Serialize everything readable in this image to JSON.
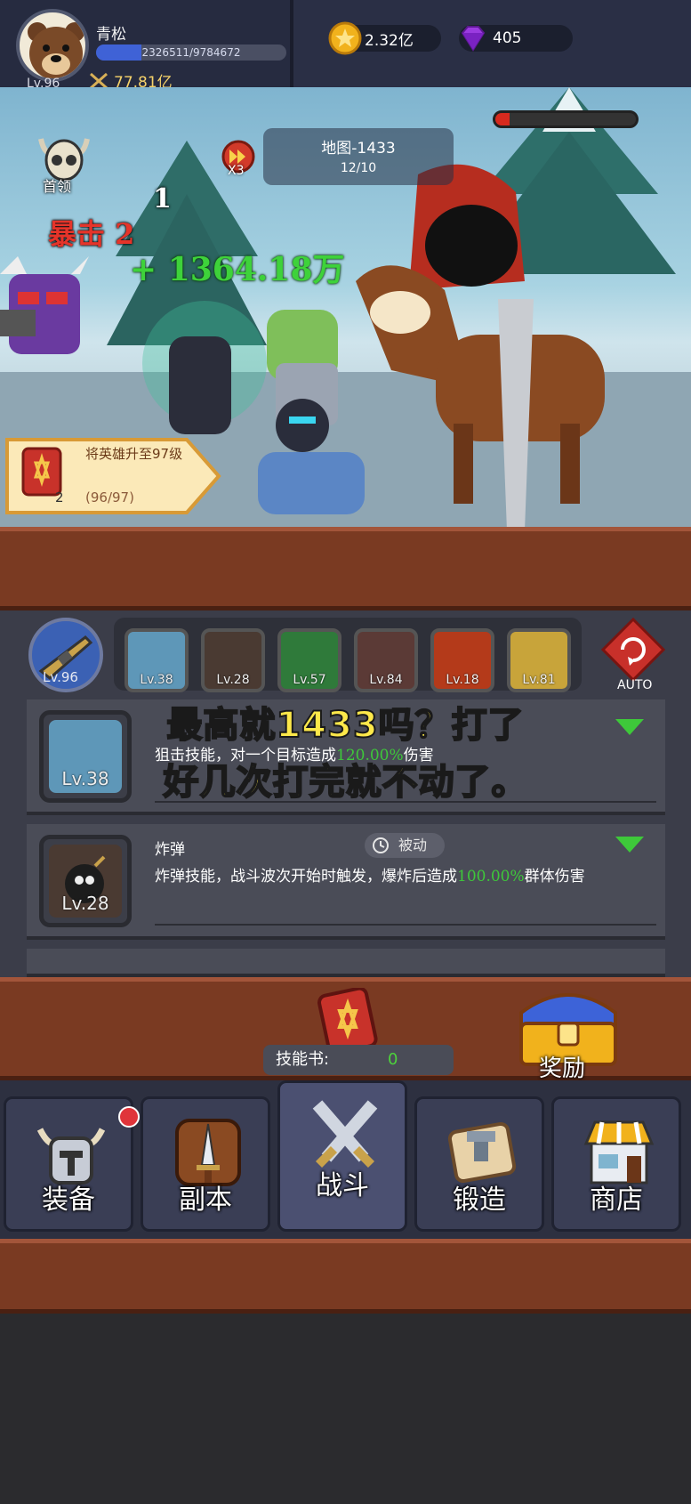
{
  "player": {
    "name": "青松",
    "level": "Lv.96",
    "exp_text": "2326511/9784672",
    "exp_progress": 0.238,
    "power": "77.81亿"
  },
  "resources": {
    "gold": "2.32亿",
    "gems": "405"
  },
  "battle": {
    "boss_label": "首领",
    "speed_label": "X3",
    "map_title": "地图-1433",
    "wave": "12/10",
    "boss_hp_progress": 0.1,
    "damage_number": "1",
    "crit_text": "暴击 2",
    "heal_text": "+ 1364.18万"
  },
  "quest": {
    "title": "将英雄升至97级",
    "progress": "(96/97)",
    "item_count": "2"
  },
  "skills_bar": {
    "weapon_level": "Lv.96",
    "items": [
      {
        "level": "Lv.38",
        "icon": "sniper-skill-icon"
      },
      {
        "level": "Lv.28",
        "icon": "bomb-skill-icon"
      },
      {
        "level": "Lv.57",
        "icon": "poison-skill-icon"
      },
      {
        "level": "Lv.84",
        "icon": "rage-skill-icon"
      },
      {
        "level": "Lv.18",
        "icon": "fireball-skill-icon"
      },
      {
        "level": "Lv.81",
        "icon": "lightning-skill-icon"
      }
    ],
    "auto_label": "AUTO"
  },
  "skill_cards": [
    {
      "name": "",
      "level": "Lv.38",
      "desc_before": "狙击技能，对一个目标造成",
      "desc_pct": "120.00%",
      "desc_after": "伤害"
    },
    {
      "name": "炸弹",
      "level": "Lv.28",
      "badge": "被动",
      "desc_before": "炸弹技能，战斗波次开始时触发，爆炸后造成",
      "desc_pct": "100.00%",
      "desc_after": "群体伤害"
    }
  ],
  "overlay": {
    "line1": "最高就1433吗？打了",
    "line2": "好几次打完就不动了。"
  },
  "footer": {
    "skill_book_label": "技能书:",
    "skill_book_count": "0",
    "reward_label": "奖励"
  },
  "nav": [
    {
      "label": "装备",
      "icon": "equipment-helmet-icon"
    },
    {
      "label": "副本",
      "icon": "dungeon-sword-icon"
    },
    {
      "label": "战斗",
      "icon": "battle-crossed-swords-icon"
    },
    {
      "label": "锻造",
      "icon": "forge-scroll-icon"
    },
    {
      "label": "商店",
      "icon": "shop-icon"
    }
  ],
  "colors": {
    "accent_green": "#3ec83a",
    "crit_red": "#e5342a",
    "gold": "#f5d26a",
    "wood": "#7a3a22"
  }
}
